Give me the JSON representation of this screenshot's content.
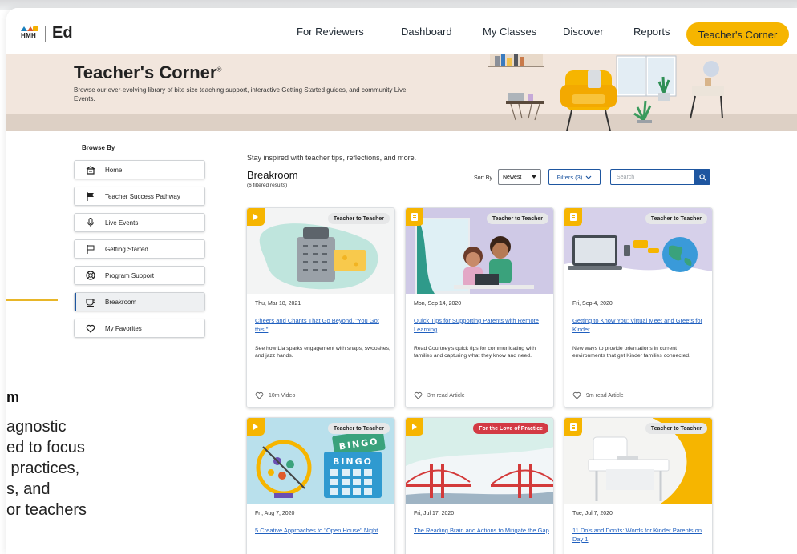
{
  "header": {
    "logo_brand": "HMH",
    "logo_product": "Ed",
    "nav": [
      {
        "label": "For Reviewers"
      },
      {
        "label": "Dashboard"
      },
      {
        "label": "My Classes"
      },
      {
        "label": "Discover"
      },
      {
        "label": "Reports"
      }
    ],
    "active_nav": "Teacher's Corner"
  },
  "hero": {
    "title": "Teacher's Corner",
    "title_mark": "®",
    "subtitle": "Browse our ever-evolving library of bite size teaching support, interactive Getting Started guides, and community Live Events."
  },
  "sidebar": {
    "heading": "Browse By",
    "items": [
      {
        "label": "Home",
        "icon": "home-icon"
      },
      {
        "label": "Teacher Success Pathway",
        "icon": "flag-filled-icon"
      },
      {
        "label": "Live Events",
        "icon": "microphone-icon"
      },
      {
        "label": "Getting Started",
        "icon": "flag-outline-icon"
      },
      {
        "label": "Program Support",
        "icon": "lifebuoy-icon"
      },
      {
        "label": "Breakroom",
        "icon": "coffee-cup-icon",
        "active": true
      },
      {
        "label": "My Favorites",
        "icon": "heart-icon"
      }
    ]
  },
  "left_partial": {
    "title": "m",
    "text": "agnostic\ned to focus\n practices,\ns, and\nor teachers"
  },
  "main": {
    "tagline": "Stay inspired with teacher tips, reflections, and more.",
    "section_title": "Breakroom",
    "section_sub": "(6 filtered results)",
    "sort_label": "Sort By",
    "sort_value": "Newest",
    "filters_label": "Filters (3)",
    "search_placeholder": "Search"
  },
  "cards": [
    {
      "media": "video",
      "tag": "Teacher to Teacher",
      "tag_style": "gray",
      "date": "Thu, Mar 18, 2021",
      "title": "Cheers and Chants That Go Beyond, \"You Got this!\"",
      "desc": "See how Lia sparks engagement with snaps, swooshes, and jazz hands.",
      "meta": "10m Video"
    },
    {
      "media": "article",
      "tag": "Teacher to Teacher",
      "tag_style": "gray",
      "date": "Mon, Sep 14, 2020",
      "title": "Quick Tips for Supporting Parents with Remote Learning",
      "desc": "Read Courtney's quick tips for communicating with families and capturing what they know and need.",
      "meta": "3m read Article"
    },
    {
      "media": "article",
      "tag": "Teacher to Teacher",
      "tag_style": "gray",
      "date": "Fri, Sep 4, 2020",
      "title": "Getting to Know You: Virtual Meet and Greets for Kinder",
      "desc": "New ways to provide orientations in current environments that get Kinder families connected.",
      "meta": "9m read Article"
    },
    {
      "media": "video",
      "tag": "Teacher to Teacher",
      "tag_style": "gray",
      "date": "Fri, Aug 7, 2020",
      "title": "5 Creative Approaches to \"Open House\" Night",
      "desc": "",
      "meta": ""
    },
    {
      "media": "video",
      "tag": "For the Love of Practice",
      "tag_style": "red",
      "date": "Fri, Jul 17, 2020",
      "title": "The Reading Brain and Actions to Mitigate the Gap",
      "desc": "",
      "meta": ""
    },
    {
      "media": "article",
      "tag": "Teacher to Teacher",
      "tag_style": "gray",
      "date": "Tue, Jul 7, 2020",
      "title": "11 Do's and Don'ts: Words for Kinder Parents on Day 1",
      "desc": "",
      "meta": ""
    }
  ],
  "bingo_words": [
    "BINGO",
    "BINGO"
  ],
  "colors": {
    "accent": "#f6b500",
    "link": "#1f5fbf",
    "primary": "#1e56a0",
    "hero_bg": "#f2e6dd",
    "tag_red": "#d33a44"
  }
}
